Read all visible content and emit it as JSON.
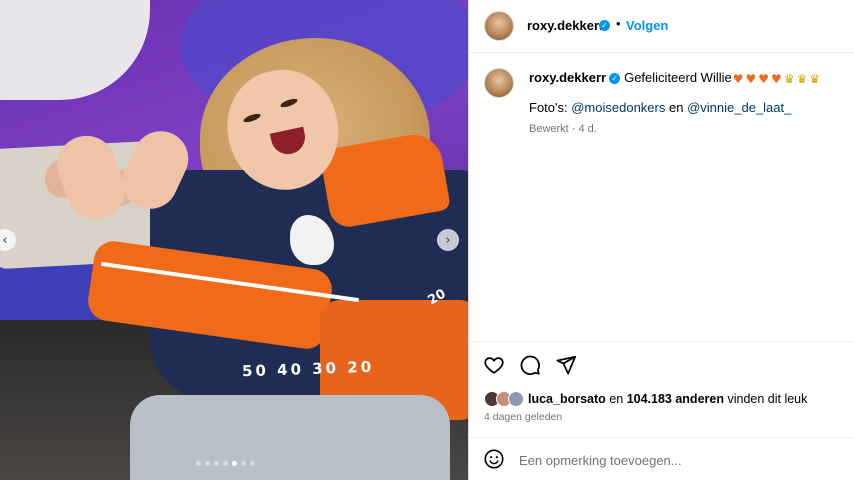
{
  "post": {
    "username": "roxy.dekkerr",
    "follow_label": "Volgen",
    "separator": "•",
    "verified_glyph": "✓",
    "caption": {
      "username": "roxy.dekkerr",
      "text": "Gefeliciteerd Willie",
      "emojis": [
        "heart-orange",
        "heart-orange",
        "heart-orange",
        "heart-orange",
        "crown",
        "crown",
        "crown"
      ],
      "credits_prefix": "Foto's:",
      "mention_1": "@moisedonkers",
      "credits_join": "en",
      "mention_2": "@vinnie_de_laat_",
      "meta": "Bewerkt · 4 d."
    },
    "likes": {
      "liker": "luca_borsato",
      "join": "en",
      "count": "104.183 anderen",
      "suffix": "vinden dit leuk"
    },
    "time_ago": "4 dagen geleden",
    "comment_placeholder": "Een opmerking toevoegen..."
  },
  "photo": {
    "yard_numbers": "50 40 30 20",
    "yard_20": "20",
    "carousel_dots": 7,
    "active_dot": 4
  },
  "icons": [
    "heart-icon",
    "comment-icon",
    "share-icon",
    "emoji-icon",
    "chevron-left-icon",
    "chevron-right-icon",
    "verified-icon"
  ],
  "colors": {
    "accent": "#0095f6",
    "mention": "#00376b",
    "muted": "#737373",
    "heart_emoji": "#f06a1a"
  }
}
